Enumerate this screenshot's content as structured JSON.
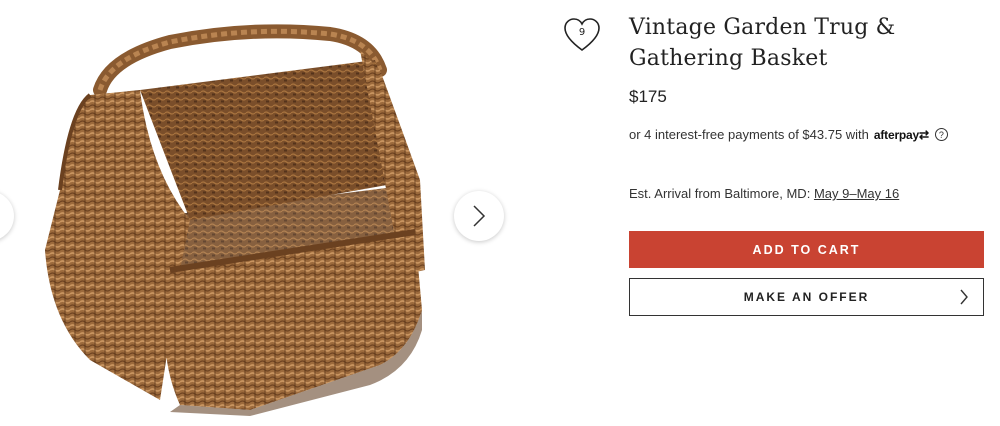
{
  "product": {
    "title_line1": "Vintage Garden Trug &",
    "title_line2": "Gathering Basket",
    "price": "$175",
    "image_alt": "Wicker garden trug basket"
  },
  "favorite": {
    "count": "9",
    "icon": "heart-icon"
  },
  "afterpay": {
    "text": "or 4 interest-free payments of $43.75 with",
    "brand": "afterpay",
    "brand_symbol": "⇄",
    "help": "?"
  },
  "shipping": {
    "label": "Est. Arrival from Baltimore, MD:",
    "dates": "May 9–May 16"
  },
  "actions": {
    "add_to_cart": "ADD TO CART",
    "make_offer": "MAKE AN OFFER"
  },
  "gallery": {
    "prev_icon": "chevron-left-icon",
    "next_icon": "chevron-right-icon"
  },
  "colors": {
    "accent": "#c94332",
    "wicker": "#9a6a3e"
  }
}
